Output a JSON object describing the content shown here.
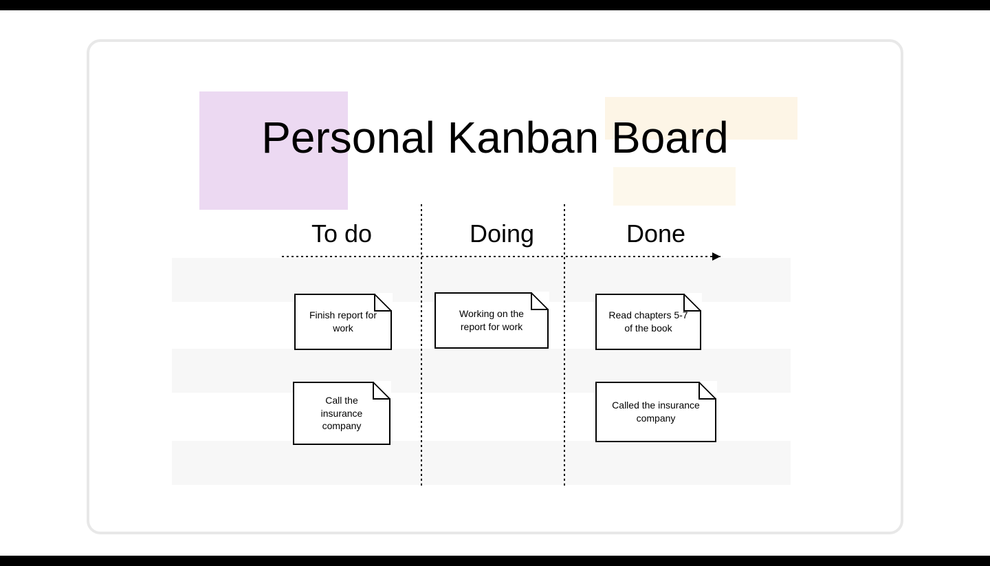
{
  "title": "Personal Kanban Board",
  "columns": {
    "todo": {
      "label": "To do"
    },
    "doing": {
      "label": "Doing"
    },
    "done": {
      "label": "Done"
    }
  },
  "cards": {
    "todo": [
      {
        "text": "Finish report for work"
      },
      {
        "text": "Call the insurance company"
      }
    ],
    "doing": [
      {
        "text": "Working on the report for work"
      }
    ],
    "done": [
      {
        "text": "Read chapters 5-7 of the book"
      },
      {
        "text": "Called the insurance company"
      }
    ]
  }
}
